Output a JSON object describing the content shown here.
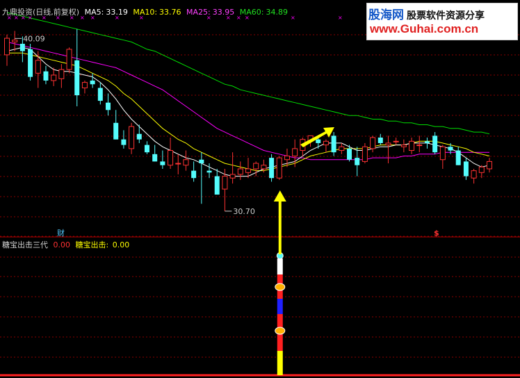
{
  "header": {
    "stock_name": "九鼎投资(日线,前复权)",
    "ma5_label": "MA5:",
    "ma5_value": "33.19",
    "ma10_label": "MA10:",
    "ma10_value": "33.76",
    "ma25_label": "MA25:",
    "ma25_value": "33.95",
    "ma60_label": "MA60:",
    "ma60_value": "34.89"
  },
  "indicator": {
    "name": "糖宝出击三代",
    "value1": "0.00",
    "series_label": "糖宝出击:",
    "value2": "0.00"
  },
  "markers": {
    "cai": "财",
    "dollar": "$"
  },
  "logo": {
    "line1_a": "股海网",
    "line1_b": "股票软件资源分享",
    "line2": "www.Guhai.com.cn"
  },
  "colors": {
    "up": "#ff3232",
    "down": "#54fcfc",
    "ma5": "#ffffff",
    "ma10": "#ffff00",
    "ma25": "#ff00ff",
    "ma60": "#00e000",
    "grid": "#8b0000",
    "arrow": "#ffff00"
  },
  "chart_data": {
    "type": "candlestick",
    "price_range": [
      29.6,
      41.5
    ],
    "annotations": [
      {
        "label": "40.09",
        "index": 1,
        "value": 40.09
      },
      {
        "label": "30.70",
        "index": 28,
        "value": 30.7
      }
    ],
    "ohlc": [
      [
        39.2,
        40.3,
        38.6,
        40.1
      ],
      [
        39.9,
        40.5,
        39.4,
        40.0
      ],
      [
        39.8,
        40.2,
        38.8,
        39.4
      ],
      [
        39.5,
        39.8,
        37.8,
        38.0
      ],
      [
        38.2,
        39.4,
        37.4,
        38.9
      ],
      [
        38.3,
        38.6,
        37.6,
        37.8
      ],
      [
        37.8,
        38.5,
        37.5,
        38.1
      ],
      [
        37.9,
        38.7,
        37.4,
        38.4
      ],
      [
        38.4,
        39.6,
        38.2,
        39.5
      ],
      [
        38.9,
        40.6,
        36.4,
        37.0
      ],
      [
        37.4,
        37.8,
        37.1,
        37.7
      ],
      [
        37.8,
        38.2,
        37.4,
        37.6
      ],
      [
        37.4,
        37.7,
        36.5,
        36.7
      ],
      [
        36.6,
        37.1,
        35.9,
        36.2
      ],
      [
        35.5,
        36.2,
        34.6,
        34.6
      ],
      [
        34.6,
        35.1,
        34.1,
        34.3
      ],
      [
        34.1,
        35.5,
        33.8,
        35.3
      ],
      [
        34.9,
        35.4,
        34.4,
        34.6
      ],
      [
        34.3,
        34.5,
        33.8,
        33.9
      ],
      [
        33.8,
        34.3,
        33.4,
        33.4
      ],
      [
        33.4,
        34.0,
        33.0,
        33.2
      ],
      [
        33.2,
        34.7,
        33.0,
        34.0
      ],
      [
        33.3,
        33.8,
        32.7,
        33.3
      ],
      [
        33.2,
        34.0,
        32.9,
        33.5
      ],
      [
        32.9,
        33.4,
        32.3,
        32.5
      ],
      [
        33.5,
        33.9,
        31.1,
        33.3
      ],
      [
        32.9,
        33.3,
        32.5,
        32.8
      ],
      [
        32.6,
        33.0,
        31.6,
        31.6
      ],
      [
        31.9,
        33.0,
        30.7,
        32.6
      ],
      [
        32.5,
        33.9,
        32.2,
        32.7
      ],
      [
        32.7,
        33.4,
        32.4,
        33.0
      ],
      [
        32.8,
        33.6,
        32.5,
        33.0
      ],
      [
        33.0,
        33.4,
        32.6,
        33.3
      ],
      [
        33.0,
        33.5,
        32.8,
        33.2
      ],
      [
        33.6,
        33.8,
        32.3,
        32.5
      ],
      [
        32.5,
        33.7,
        32.4,
        33.6
      ],
      [
        33.5,
        34.1,
        33.1,
        33.7
      ],
      [
        33.7,
        34.6,
        33.1,
        34.1
      ],
      [
        34.0,
        34.7,
        33.7,
        34.6
      ],
      [
        34.5,
        34.8,
        34.2,
        34.8
      ],
      [
        34.6,
        34.8,
        34.1,
        34.4
      ],
      [
        34.3,
        34.6,
        33.9,
        34.5
      ],
      [
        34.8,
        35.0,
        33.7,
        33.9
      ],
      [
        34.0,
        34.4,
        33.8,
        34.2
      ],
      [
        34.1,
        34.3,
        33.4,
        33.5
      ],
      [
        33.6,
        34.2,
        32.6,
        33.2
      ],
      [
        33.4,
        34.4,
        33.3,
        34.2
      ],
      [
        34.1,
        34.8,
        33.9,
        34.7
      ],
      [
        34.7,
        34.9,
        34.3,
        34.4
      ],
      [
        34.3,
        34.8,
        33.3,
        34.4
      ],
      [
        34.5,
        34.7,
        34.3,
        34.5
      ],
      [
        34.2,
        34.6,
        33.9,
        34.3
      ],
      [
        34.0,
        34.7,
        33.8,
        34.5
      ],
      [
        34.3,
        34.8,
        33.9,
        34.3
      ],
      [
        34.5,
        34.7,
        34.1,
        34.4
      ],
      [
        34.8,
        35.0,
        33.8,
        33.9
      ],
      [
        33.5,
        34.3,
        33.0,
        34.2
      ],
      [
        34.2,
        34.4,
        33.8,
        34.0
      ],
      [
        34.0,
        34.2,
        33.2,
        33.2
      ],
      [
        33.4,
        33.6,
        32.4,
        32.6
      ],
      [
        32.5,
        33.0,
        32.2,
        32.9
      ],
      [
        32.8,
        33.2,
        32.5,
        33.1
      ],
      [
        33.0,
        33.6,
        32.8,
        33.4
      ]
    ],
    "ma5": [
      39.4,
      39.5,
      39.6,
      39.5,
      39.1,
      38.7,
      38.4,
      38.3,
      38.3,
      38.2,
      38.1,
      38.0,
      37.7,
      37.3,
      36.8,
      36.2,
      35.7,
      35.3,
      34.9,
      34.5,
      34.2,
      34.0,
      33.8,
      33.6,
      33.5,
      33.3,
      33.1,
      32.9,
      32.7,
      32.6,
      32.6,
      32.6,
      32.8,
      33.0,
      33.1,
      33.2,
      33.3,
      33.4,
      33.7,
      34.0,
      34.2,
      34.4,
      34.4,
      34.4,
      34.2,
      34.0,
      34.0,
      34.1,
      34.2,
      34.2,
      34.3,
      34.3,
      34.4,
      34.4,
      34.4,
      34.3,
      34.2,
      34.1,
      33.9,
      33.6,
      33.3,
      33.1,
      33.2
    ],
    "ma10": [
      39.3,
      39.3,
      39.3,
      39.2,
      39.1,
      39.0,
      38.9,
      38.8,
      38.7,
      38.6,
      38.4,
      38.2,
      38.0,
      37.8,
      37.5,
      37.1,
      36.8,
      36.4,
      36.0,
      35.6,
      35.2,
      34.9,
      34.6,
      34.4,
      34.1,
      33.9,
      33.7,
      33.5,
      33.3,
      33.2,
      33.1,
      33.0,
      32.9,
      32.9,
      33.0,
      33.1,
      33.2,
      33.3,
      33.5,
      33.7,
      33.8,
      33.9,
      34.0,
      34.1,
      34.1,
      34.1,
      34.1,
      34.2,
      34.3,
      34.3,
      34.3,
      34.3,
      34.4,
      34.5,
      34.5,
      34.5,
      34.4,
      34.3,
      34.2,
      34.1,
      33.9,
      33.8,
      33.7
    ],
    "ma25": [
      39.9,
      39.8,
      39.7,
      39.6,
      39.5,
      39.4,
      39.3,
      39.2,
      39.1,
      39.0,
      38.9,
      38.8,
      38.7,
      38.6,
      38.5,
      38.3,
      38.1,
      37.9,
      37.7,
      37.5,
      37.3,
      37.0,
      36.7,
      36.4,
      36.1,
      35.8,
      35.5,
      35.2,
      35.0,
      34.8,
      34.6,
      34.4,
      34.2,
      34.0,
      33.9,
      33.8,
      33.7,
      33.6,
      33.6,
      33.5,
      33.5,
      33.5,
      33.5,
      33.5,
      33.5,
      33.5,
      33.5,
      33.6,
      33.6,
      33.6,
      33.6,
      33.7,
      33.7,
      33.8,
      33.8,
      33.8,
      33.9,
      33.9,
      33.9,
      33.9,
      33.9,
      33.9,
      33.9
    ],
    "ma60": [
      41.5,
      41.4,
      41.3,
      41.2,
      41.1,
      41.0,
      40.9,
      40.8,
      40.7,
      40.6,
      40.5,
      40.4,
      40.3,
      40.2,
      40.1,
      40.0,
      39.9,
      39.7,
      39.5,
      39.4,
      39.2,
      39.0,
      38.8,
      38.6,
      38.4,
      38.2,
      38.0,
      37.8,
      37.6,
      37.5,
      37.3,
      37.2,
      37.1,
      37.0,
      36.9,
      36.8,
      36.7,
      36.6,
      36.5,
      36.4,
      36.3,
      36.2,
      36.1,
      36.0,
      35.9,
      35.9,
      35.8,
      35.7,
      35.7,
      35.6,
      35.6,
      35.5,
      35.5,
      35.4,
      35.4,
      35.3,
      35.3,
      35.2,
      35.2,
      35.1,
      35.0,
      35.0,
      34.9
    ],
    "signal_index": 35
  }
}
